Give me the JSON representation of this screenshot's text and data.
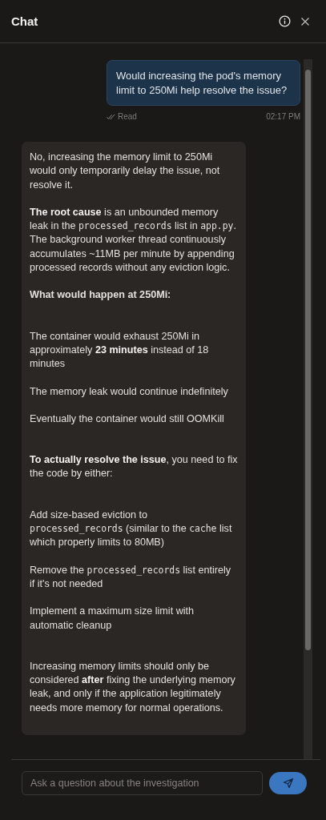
{
  "header": {
    "title": "Chat"
  },
  "user_message": {
    "text": "Would increasing the pod's memory limit to 250Mi help resolve the issue?",
    "status": "Read",
    "time": "02:17 PM"
  },
  "assistant_message": {
    "blocks": [
      {
        "kind": "paragraph",
        "parts": [
          {
            "kind": "plain",
            "text": "No, increasing the memory limit to 250Mi would only temporarily delay the issue, not resolve it."
          }
        ]
      },
      {
        "kind": "paragraph",
        "parts": [
          {
            "kind": "bold",
            "text": "The root cause"
          },
          {
            "kind": "plain",
            "text": " is an unbounded memory leak in the "
          },
          {
            "kind": "code",
            "text": "processed_records"
          },
          {
            "kind": "plain",
            "text": " list in "
          },
          {
            "kind": "code",
            "text": "app.py"
          },
          {
            "kind": "plain",
            "text": ". The background worker thread continuously accumulates ~11MB per minute by appending processed records without any eviction logic."
          }
        ]
      },
      {
        "kind": "heading",
        "parts": [
          {
            "kind": "plain",
            "text": "What would happen at 250Mi:"
          }
        ]
      },
      {
        "kind": "list",
        "items": [
          [
            {
              "kind": "plain",
              "text": "The container would exhaust 250Mi in approximately "
            },
            {
              "kind": "bold",
              "text": "23 minutes"
            },
            {
              "kind": "plain",
              "text": " instead of 18 minutes"
            }
          ],
          [
            {
              "kind": "plain",
              "text": "The memory leak would continue indefinitely"
            }
          ],
          [
            {
              "kind": "plain",
              "text": "Eventually the container would still OOMKill"
            }
          ]
        ]
      },
      {
        "kind": "paragraph",
        "parts": [
          {
            "kind": "bold",
            "text": "To actually resolve the issue"
          },
          {
            "kind": "plain",
            "text": ", you need to fix the code by either:"
          }
        ]
      },
      {
        "kind": "list",
        "items": [
          [
            {
              "kind": "plain",
              "text": "Add size-based eviction to "
            },
            {
              "kind": "code",
              "text": "processed_records"
            },
            {
              "kind": "plain",
              "text": " (similar to the "
            },
            {
              "kind": "code",
              "text": "cache"
            },
            {
              "kind": "plain",
              "text": " list which properly limits to 80MB)"
            }
          ],
          [
            {
              "kind": "plain",
              "text": "Remove the "
            },
            {
              "kind": "code",
              "text": "processed_records"
            },
            {
              "kind": "plain",
              "text": " list entirely if it's not needed"
            }
          ],
          [
            {
              "kind": "plain",
              "text": "Implement a maximum size limit with automatic cleanup"
            }
          ]
        ]
      },
      {
        "kind": "paragraph",
        "parts": [
          {
            "kind": "plain",
            "text": "Increasing memory limits should only be considered "
          },
          {
            "kind": "bold",
            "text": "after"
          },
          {
            "kind": "plain",
            "text": " fixing the underlying memory leak, and only if the application legitimately needs more memory for normal operations."
          }
        ]
      }
    ]
  },
  "composer": {
    "placeholder": "Ask a question about the investigation"
  }
}
